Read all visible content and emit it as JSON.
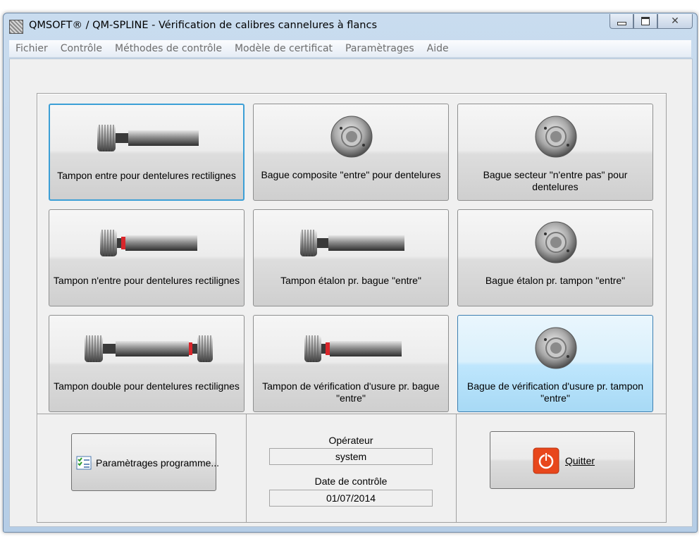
{
  "window": {
    "title": "QMSOFT® / QM-SPLINE - Vérification de calibres cannelures à flancs",
    "icon": "app-icon",
    "caption_buttons": {
      "minimize": "minimize-icon",
      "maximize": "maximize-icon",
      "close": "close-icon"
    }
  },
  "menu": [
    "Fichier",
    "Contrôle",
    "Méthodes de contrôle",
    "Modèle de certificat",
    "Paramètrages",
    "Aide"
  ],
  "gauges": [
    {
      "label": "Tampon entre pour dentelures rectilignes",
      "image": "plug-gauge-go-icon",
      "state": "focused"
    },
    {
      "label": "Bague composite \"entre\" pour dentelures",
      "image": "ring-gauge-icon",
      "state": "normal"
    },
    {
      "label": "Bague secteur \"n'entre pas\" pour dentelures",
      "image": "ring-gauge-icon",
      "state": "normal"
    },
    {
      "label": "Tampon n'entre pour dentelures rectilignes",
      "image": "plug-gauge-nogo-icon",
      "state": "normal"
    },
    {
      "label": "Tampon étalon pr. bague \"entre\"",
      "image": "plug-gauge-icon",
      "state": "normal"
    },
    {
      "label": "Bague étalon pr. tampon \"entre\"",
      "image": "ring-gauge-icon",
      "state": "normal"
    },
    {
      "label": "Tampon double pour dentelures rectilignes",
      "image": "double-plug-gauge-icon",
      "state": "normal"
    },
    {
      "label": "Tampon de vérification d'usure pr. bague \"entre\"",
      "image": "plug-gauge-nogo-icon",
      "state": "normal"
    },
    {
      "label": "Bague de vérification d'usure pr. tampon \"entre\"",
      "image": "ring-gauge-icon",
      "state": "hot"
    }
  ],
  "footer": {
    "params_button_label": "Paramètrages programme...",
    "params_icon": "checklist-icon",
    "operator_label": "Opérateur",
    "operator_value": "system",
    "date_label": "Date de contrôle",
    "date_value": "01/07/2014",
    "quit_label": "Quitter",
    "quit_icon": "power-icon"
  },
  "colors": {
    "focus": "#3c9fd6",
    "hot": "#bee6fd",
    "quit_icon": "#e8471c"
  }
}
